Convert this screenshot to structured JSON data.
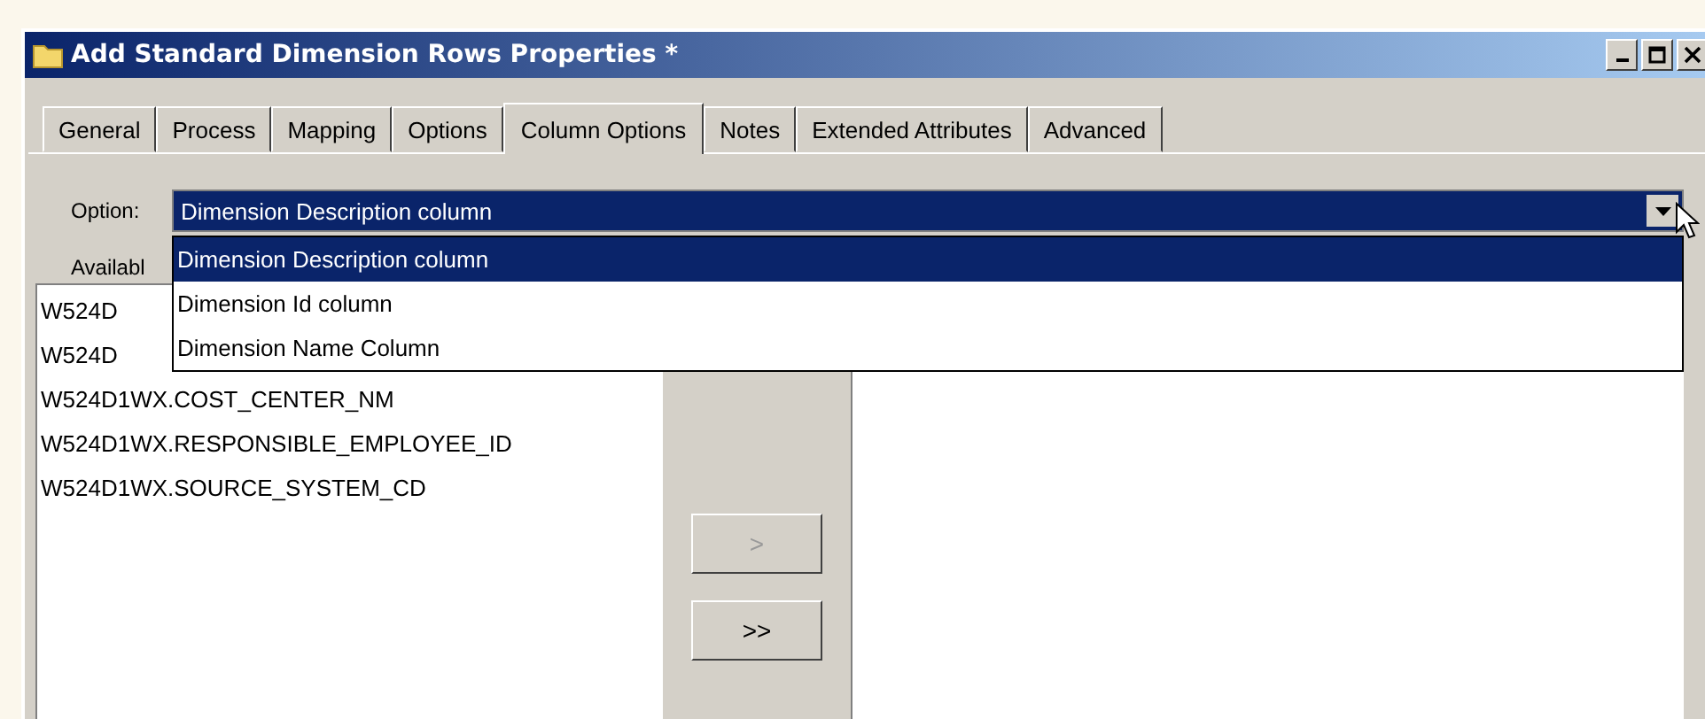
{
  "window": {
    "title": "Add Standard Dimension Rows Properties *"
  },
  "tabs": [
    {
      "label": "General",
      "selected": false
    },
    {
      "label": "Process",
      "selected": false
    },
    {
      "label": "Mapping",
      "selected": false
    },
    {
      "label": "Options",
      "selected": false
    },
    {
      "label": "Column Options",
      "selected": true
    },
    {
      "label": "Notes",
      "selected": false
    },
    {
      "label": "Extended Attributes",
      "selected": false
    },
    {
      "label": "Advanced",
      "selected": false
    }
  ],
  "option": {
    "label": "Option:",
    "value": "Dimension Description column",
    "choices": [
      {
        "label": "Dimension Description column",
        "selected": true
      },
      {
        "label": "Dimension Id column",
        "selected": false
      },
      {
        "label": "Dimension Name Column",
        "selected": false
      }
    ]
  },
  "available": {
    "label": "Availabl",
    "items": [
      "W524D",
      "W524D",
      "W524D1WX.COST_CENTER_NM",
      "W524D1WX.RESPONSIBLE_EMPLOYEE_ID",
      "W524D1WX.SOURCE_SYSTEM_CD"
    ]
  },
  "move_buttons": [
    {
      "label": ">",
      "disabled": true
    },
    {
      "label": ">>",
      "disabled": false
    }
  ]
}
